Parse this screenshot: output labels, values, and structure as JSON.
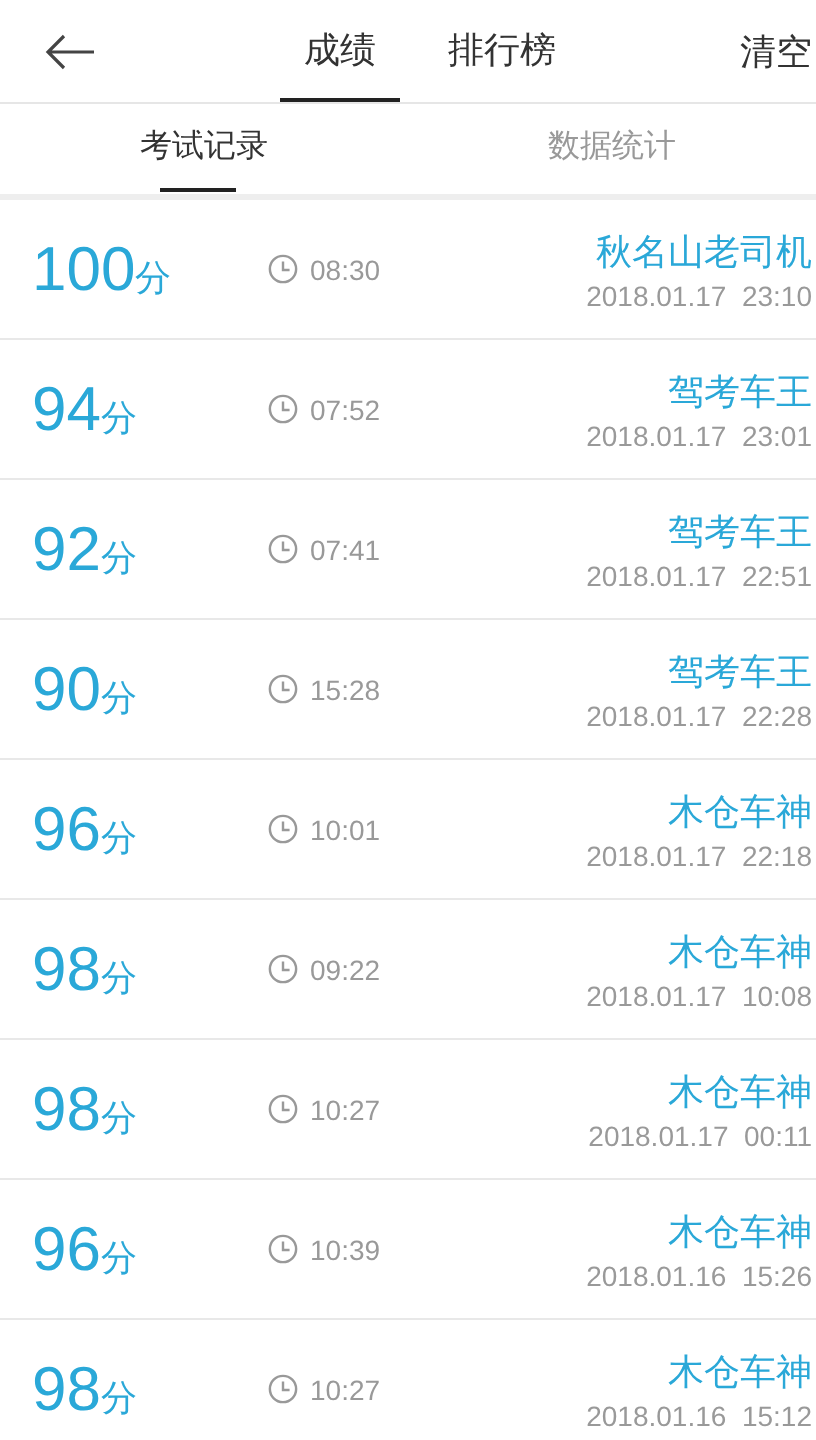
{
  "header": {
    "tabs": [
      {
        "label": "成绩",
        "selected": true
      },
      {
        "label": "排行榜",
        "selected": false
      }
    ],
    "action": "清空"
  },
  "subtabs": [
    {
      "label": "考试记录",
      "selected": true
    },
    {
      "label": "数据统计",
      "selected": false
    }
  ],
  "records": [
    {
      "score": "100",
      "unit": "分",
      "duration": "08:30",
      "name": "秋名山老司机",
      "datetime": "2018.01.17  23:10"
    },
    {
      "score": "94",
      "unit": "分",
      "duration": "07:52",
      "name": "驾考车王",
      "datetime": "2018.01.17  23:01"
    },
    {
      "score": "92",
      "unit": "分",
      "duration": "07:41",
      "name": "驾考车王",
      "datetime": "2018.01.17  22:51"
    },
    {
      "score": "90",
      "unit": "分",
      "duration": "15:28",
      "name": "驾考车王",
      "datetime": "2018.01.17  22:28"
    },
    {
      "score": "96",
      "unit": "分",
      "duration": "10:01",
      "name": "木仓车神",
      "datetime": "2018.01.17  22:18"
    },
    {
      "score": "98",
      "unit": "分",
      "duration": "09:22",
      "name": "木仓车神",
      "datetime": "2018.01.17  10:08"
    },
    {
      "score": "98",
      "unit": "分",
      "duration": "10:27",
      "name": "木仓车神",
      "datetime": "2018.01.17  00:11"
    },
    {
      "score": "96",
      "unit": "分",
      "duration": "10:39",
      "name": "木仓车神",
      "datetime": "2018.01.16  15:26"
    },
    {
      "score": "98",
      "unit": "分",
      "duration": "10:27",
      "name": "木仓车神",
      "datetime": "2018.01.16  15:12"
    }
  ]
}
